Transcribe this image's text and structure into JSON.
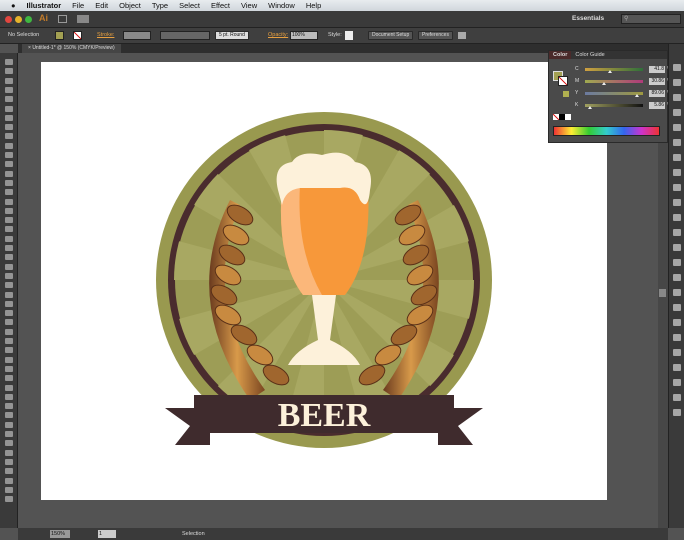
{
  "menubar": {
    "apple": "",
    "items": [
      "Illustrator",
      "File",
      "Edit",
      "Object",
      "Type",
      "Select",
      "Effect",
      "View",
      "Window",
      "Help"
    ]
  },
  "appbar": {
    "logo": "Ai",
    "workspace": "Essentials",
    "search_placeholder": ""
  },
  "control": {
    "selection": "No Selection",
    "stroke_label": "Stroke:",
    "brush": "5 pt. Round",
    "opacity_label": "Opacity:",
    "opacity": "100%",
    "style_label": "Style:",
    "document_setup": "Document Setup",
    "preferences": "Preferences"
  },
  "document_tab": {
    "title": "Untitled-1* @ 150% (CMYK/Preview)"
  },
  "color_panel": {
    "tabs": [
      "Color",
      "Color Guide"
    ],
    "channels": [
      {
        "name": "C",
        "value": "41.8",
        "fraction": 0.418,
        "gradient": "#cfa040,#2f6f3a"
      },
      {
        "name": "M",
        "value": "30.86",
        "fraction": 0.3086,
        "gradient": "#9faa50,#b03a7a"
      },
      {
        "name": "Y",
        "value": "89.06",
        "fraction": 0.8906,
        "gradient": "#6b7aa0,#9f9a40"
      },
      {
        "name": "K",
        "value": "5.86",
        "fraction": 0.0586,
        "gradient": "#a0a060,#111111"
      }
    ],
    "pct": "%",
    "fill_color": "#a3a052"
  },
  "artwork": {
    "text": "BEER",
    "colors": {
      "badge": "#99994f",
      "ring": "#4a2c2e",
      "ribbon": "#3f2b2d",
      "beer": "#f7983a",
      "foam": "#fdf1da",
      "wheat": "#b87a3a"
    }
  },
  "status": {
    "zoom": "150%",
    "artboard": "1",
    "tool": "Selection"
  }
}
